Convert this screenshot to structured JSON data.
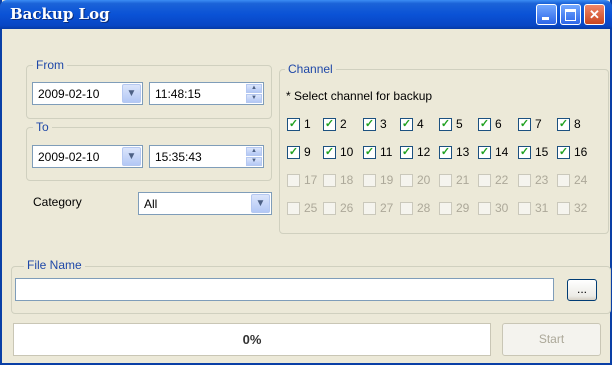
{
  "window": {
    "title": "Backup Log"
  },
  "titlebar_buttons": {
    "minimize_icon": "minimize-icon",
    "maximize_icon": "maximize-icon",
    "close_icon": "close-icon",
    "close_glyph": "✕"
  },
  "from": {
    "label": "From",
    "date": "2009-02-10",
    "time": "11:48:15"
  },
  "to": {
    "label": "To",
    "date": "2009-02-10",
    "time": "15:35:43"
  },
  "category": {
    "label": "Category",
    "value": "All"
  },
  "channel": {
    "label": "Channel",
    "hint": "* Select channel for backup",
    "items": [
      {
        "n": "1",
        "checked": true
      },
      {
        "n": "2",
        "checked": true
      },
      {
        "n": "3",
        "checked": true
      },
      {
        "n": "4",
        "checked": true
      },
      {
        "n": "5",
        "checked": true
      },
      {
        "n": "6",
        "checked": true
      },
      {
        "n": "7",
        "checked": true
      },
      {
        "n": "8",
        "checked": true
      },
      {
        "n": "9",
        "checked": true
      },
      {
        "n": "10",
        "checked": true
      },
      {
        "n": "11",
        "checked": true
      },
      {
        "n": "12",
        "checked": true
      },
      {
        "n": "13",
        "checked": true
      },
      {
        "n": "14",
        "checked": true
      },
      {
        "n": "15",
        "checked": true
      },
      {
        "n": "16",
        "checked": true
      },
      {
        "n": "17",
        "checked": false,
        "disabled": true
      },
      {
        "n": "18",
        "checked": false,
        "disabled": true
      },
      {
        "n": "19",
        "checked": false,
        "disabled": true
      },
      {
        "n": "20",
        "checked": false,
        "disabled": true
      },
      {
        "n": "21",
        "checked": false,
        "disabled": true
      },
      {
        "n": "22",
        "checked": false,
        "disabled": true
      },
      {
        "n": "23",
        "checked": false,
        "disabled": true
      },
      {
        "n": "24",
        "checked": false,
        "disabled": true
      },
      {
        "n": "25",
        "checked": false,
        "disabled": true
      },
      {
        "n": "26",
        "checked": false,
        "disabled": true
      },
      {
        "n": "27",
        "checked": false,
        "disabled": true
      },
      {
        "n": "28",
        "checked": false,
        "disabled": true
      },
      {
        "n": "29",
        "checked": false,
        "disabled": true
      },
      {
        "n": "30",
        "checked": false,
        "disabled": true
      },
      {
        "n": "31",
        "checked": false,
        "disabled": true
      },
      {
        "n": "32",
        "checked": false,
        "disabled": true
      }
    ]
  },
  "file": {
    "label": "File Name",
    "value": "",
    "browse_label": "..."
  },
  "progress": {
    "value": 0,
    "text": "0%"
  },
  "start_button": {
    "label": "Start",
    "enabled": false
  },
  "glyphs": {
    "dropdown": "▼",
    "spin_up": "▲",
    "spin_down": "▼",
    "check": "✓"
  },
  "colors": {
    "titlebar": "#0a52d6",
    "legend_text": "#1f48a8",
    "check": "#21a121",
    "disabled_text": "#aca899"
  }
}
